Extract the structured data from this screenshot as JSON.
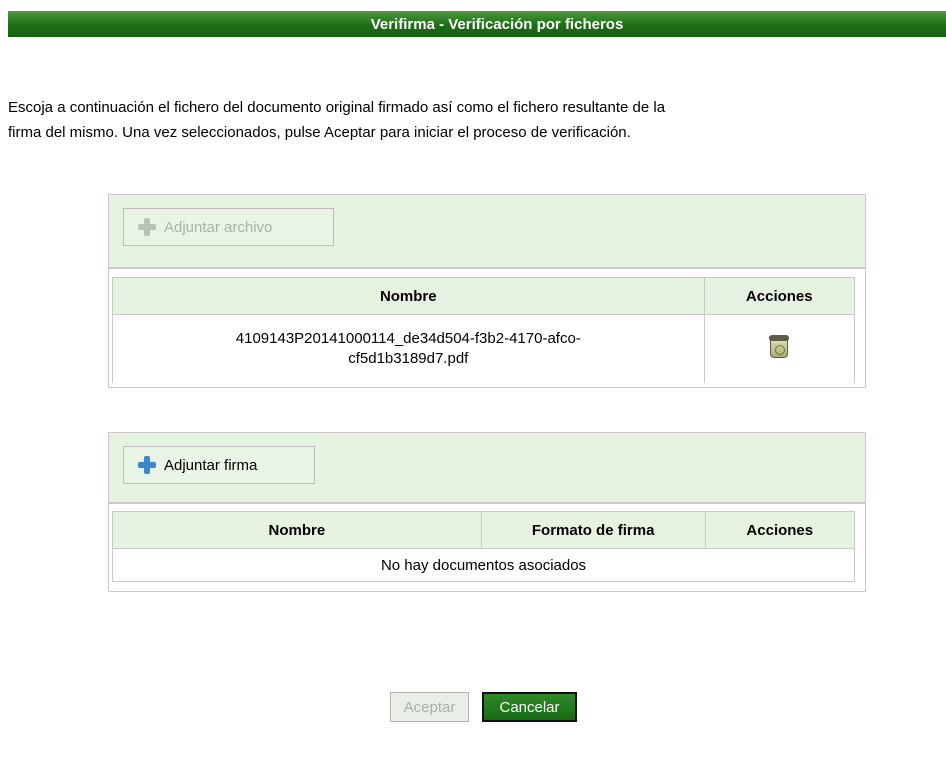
{
  "header": {
    "title": "Verifirma - Verificación por ficheros"
  },
  "intro": {
    "line1": "Escoja a continuación el fichero del documento original firmado así como el fichero resultante de la",
    "line2": "firma del mismo. Una vez seleccionados, pulse Aceptar para iniciar el proceso de verificación."
  },
  "archivo_panel": {
    "attach_label": "Adjuntar archivo",
    "attach_enabled": false,
    "columns": [
      "Nombre",
      "Acciones"
    ],
    "rows": [
      {
        "name_line1": "4109143P20141000114_de34d504-f3b2-4170-afco-",
        "name_line2": "cf5d1b3189d7.pdf",
        "action_icon": "trash-icon"
      }
    ]
  },
  "firma_panel": {
    "attach_label": "Adjuntar firma",
    "attach_enabled": true,
    "columns": [
      "Nombre",
      "Formato de firma",
      "Acciones"
    ],
    "empty_text": "No hay documentos asociados"
  },
  "footer": {
    "accept_label": "Aceptar",
    "accept_enabled": false,
    "cancel_label": "Cancelar"
  },
  "colors": {
    "header_green": "#1f6e16",
    "panel_bg": "#e6f3e0",
    "plus_blue": "#3b86c8"
  }
}
